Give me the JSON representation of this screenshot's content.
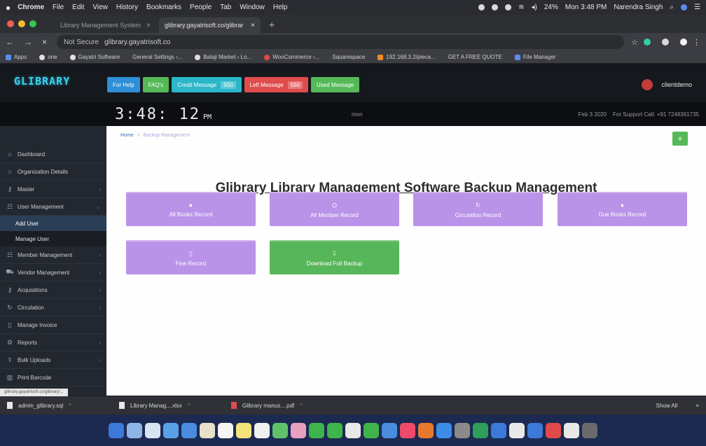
{
  "menubar": {
    "items": [
      "Chrome",
      "File",
      "Edit",
      "View",
      "History",
      "Bookmarks",
      "People",
      "Tab",
      "Window",
      "Help"
    ],
    "battery": "24%",
    "clock": "Mon 3:48 PM",
    "user": "Narendra Singh"
  },
  "tabs": [
    {
      "title": "Library Management System"
    },
    {
      "title": "glibrary.gayatrisoft.co/glibrar"
    }
  ],
  "address": {
    "security": "Not Secure",
    "url": "glibrary.gayatrisoft.co"
  },
  "bookmarks": [
    "Apps",
    "one",
    "Gayatri Software",
    "General Settings ‹...",
    "Balaji Market ‹ Lo...",
    "WooCommerce ‹...",
    "Squarespace",
    "192.168.3.2/pieca...",
    "GET A FREE QUOTE",
    "File Manager"
  ],
  "app": {
    "logo": "GLIBRARY",
    "buttons": [
      {
        "label": "For Help",
        "color": "#2f8fd6"
      },
      {
        "label": "FAQ's",
        "color": "#55b957"
      },
      {
        "label": "Credit Message",
        "count": "550",
        "color": "#2bb6c9"
      },
      {
        "label": "Left Message",
        "count": "550",
        "color": "#df4c4c"
      },
      {
        "label": "Used Message",
        "color": "#55b957"
      }
    ],
    "username": "clientdemo"
  },
  "clockbar": {
    "time": "3:48: 12",
    "ampm": "PM",
    "day": "mon",
    "date": "Feb 3 2020",
    "support": "For Support Call: +91 7248361735"
  },
  "sidebar": {
    "items": [
      {
        "label": "Dashboard",
        "icon": "home-icon",
        "glyph": "⌂"
      },
      {
        "label": "Organization Details",
        "icon": "home-icon",
        "glyph": "⌂"
      },
      {
        "label": "Master",
        "icon": "key-icon",
        "glyph": "⚷"
      },
      {
        "label": "User Management",
        "icon": "users-icon",
        "glyph": "☷"
      }
    ],
    "subitems": [
      "Add User",
      "Manage User"
    ],
    "items2": [
      {
        "label": "Member Management",
        "icon": "users-icon",
        "glyph": "☷"
      },
      {
        "label": "Vendor Management",
        "icon": "truck-icon",
        "glyph": "⛟"
      },
      {
        "label": "Acquisitions",
        "icon": "key-icon",
        "glyph": "⚷"
      },
      {
        "label": "Circulation",
        "icon": "refresh-icon",
        "glyph": "↻"
      },
      {
        "label": "Manage Invoice",
        "icon": "file-icon",
        "glyph": "▯"
      },
      {
        "label": "Reports",
        "icon": "gear-icon",
        "glyph": "⚙"
      },
      {
        "label": "Bulk Uploads",
        "icon": "upload-icon",
        "glyph": "⇪"
      },
      {
        "label": "Print Barcode",
        "icon": "barcode-icon",
        "glyph": "▥"
      }
    ]
  },
  "main": {
    "breadcrumb_home": "Home",
    "breadcrumb_current": "Backup Management",
    "title": "Glibrary Library Management Software Backup Management",
    "cards": [
      {
        "label": "All Books Record",
        "icon": "book-icon",
        "glyph": "●"
      },
      {
        "label": "All Member Record",
        "icon": "member-icon",
        "glyph": "⛭"
      },
      {
        "label": "Circulation Record",
        "icon": "refresh-icon",
        "glyph": "↻"
      },
      {
        "label": "Due Books Record",
        "icon": "book-icon",
        "glyph": "●"
      },
      {
        "label": "Fine Record",
        "icon": "file-icon",
        "glyph": "▯"
      },
      {
        "label": "Download Full Backup",
        "icon": "download-icon",
        "glyph": "⇩"
      }
    ]
  },
  "statusbar": {
    "url": "glibrary.gayatrisoft.co/glibrary/..."
  },
  "downloads": {
    "files": [
      "admin_glibrary.sql",
      "Library Manag....xlsx",
      "Glibrary manus....pdf"
    ],
    "show_all": "Show All"
  }
}
